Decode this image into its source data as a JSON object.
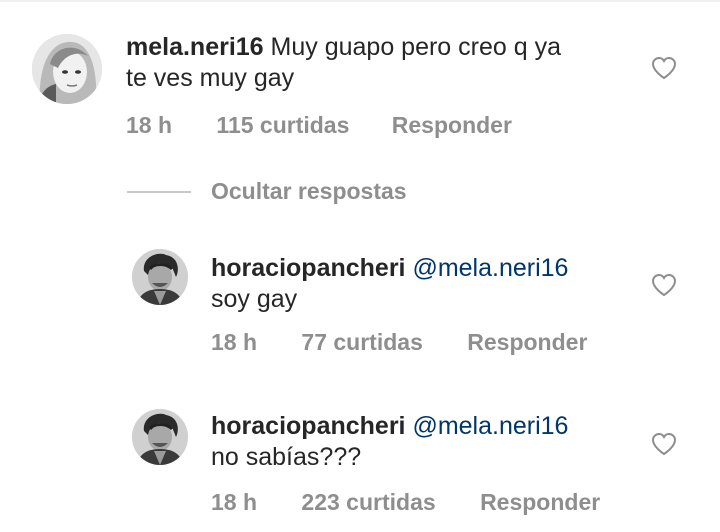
{
  "comments": [
    {
      "username": "mela.neri16",
      "text_line1": " Muy guapo pero creo q ya",
      "text_line2": "te ves muy gay",
      "time": "18 h",
      "likes": "115 curtidas",
      "reply": "Responder",
      "avatar": "woman-portrait-grayscale"
    }
  ],
  "hide_replies": "Ocultar respostas",
  "replies": [
    {
      "username": "horaciopancheri",
      "mention": "@mela.neri16",
      "text": "soy gay",
      "time": "18 h",
      "likes": "77 curtidas",
      "reply": "Responder",
      "avatar": "man-portrait-grayscale"
    },
    {
      "username": "horaciopancheri",
      "mention": "@mela.neri16",
      "text": "no sabías???",
      "time": "18 h",
      "likes": "223 curtidas",
      "reply": "Responder",
      "avatar": "man-portrait-grayscale"
    }
  ],
  "colors": {
    "text": "#262626",
    "meta": "#8e8e8e",
    "mention": "#00376b",
    "divider": "#c7c7c7"
  },
  "icons": {
    "like": "heart-outline-icon"
  }
}
